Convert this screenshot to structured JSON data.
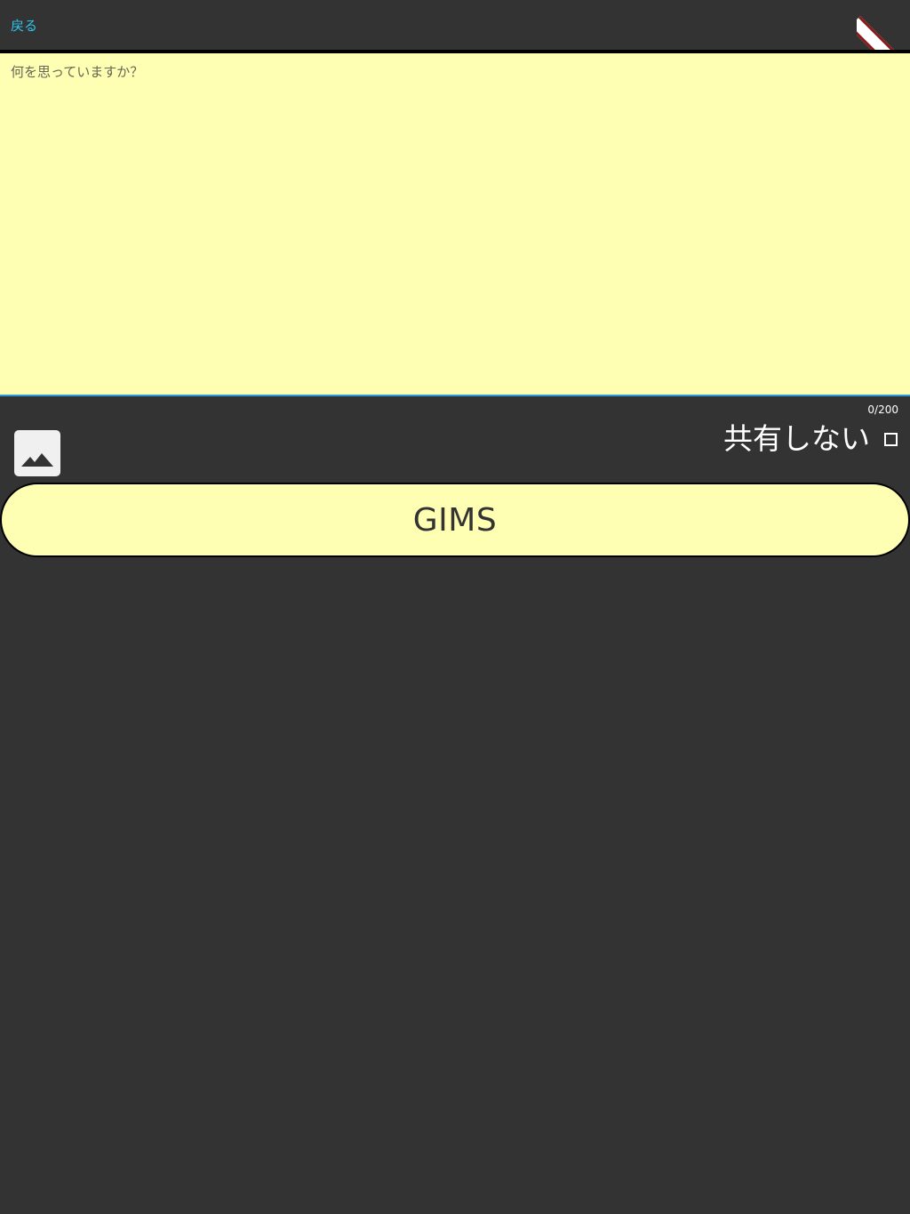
{
  "topbar": {
    "back_label": "戻る"
  },
  "editor": {
    "placeholder": "何を思っていますか？",
    "value": ""
  },
  "counter": {
    "text": "0/200"
  },
  "share": {
    "label": "共有しない",
    "checked": false
  },
  "gims_button": {
    "label": "GIMS"
  },
  "colors": {
    "background": "#333333",
    "editor_bg": "#ffffb3",
    "accent_blue": "#2b9cd8",
    "link_cyan": "#2ec4f0",
    "divider": "#000000"
  },
  "icons": {
    "image_button": "image-icon",
    "debug_banner": "debug-banner"
  }
}
